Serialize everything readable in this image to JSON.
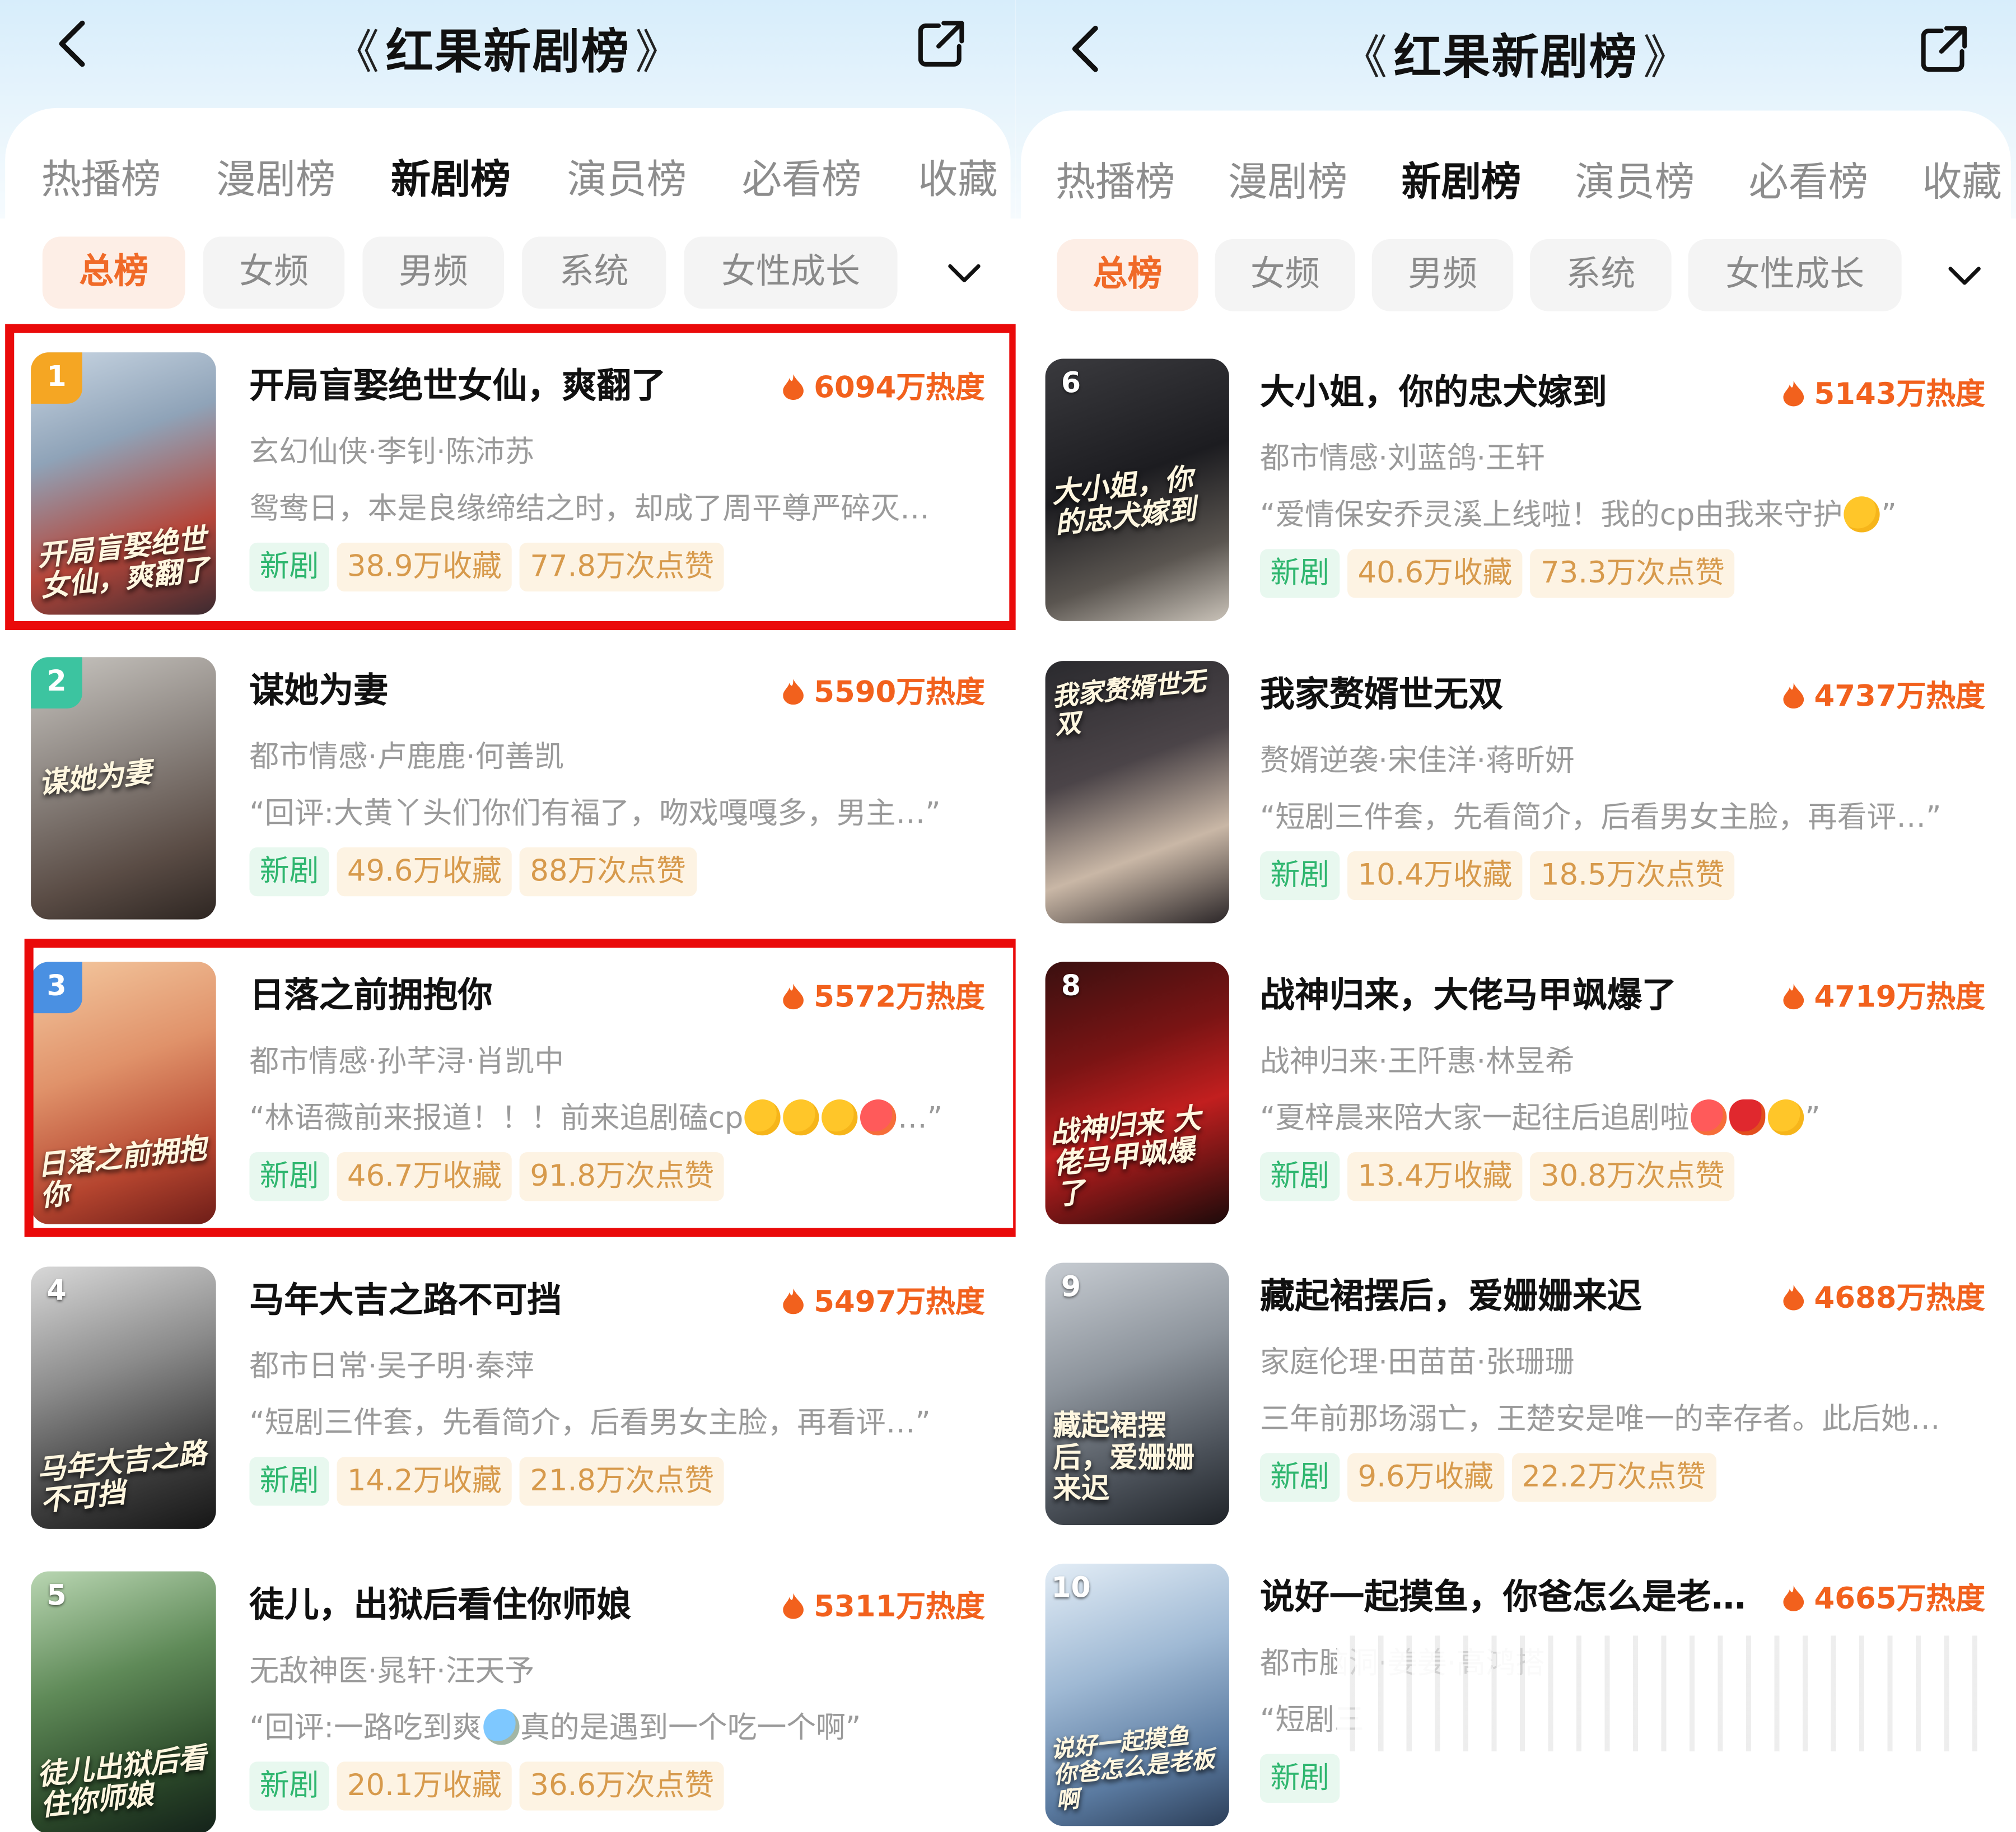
{
  "header": {
    "title": "红果新剧榜",
    "laurel_left": "《",
    "laurel_right": "》"
  },
  "tabs": [
    "热播榜",
    "漫剧榜",
    "新剧榜",
    "演员榜",
    "必看榜",
    "收藏"
  ],
  "active_tab": "新剧榜",
  "chips": [
    "总榜",
    "女频",
    "男频",
    "系统",
    "女性成长"
  ],
  "active_chip": "总榜",
  "left_list": [
    {
      "rank": "1",
      "title": "开局盲娶绝世女仙，爽翻了",
      "heat": "6094万热度",
      "meta": "玄幻仙侠·李钊·陈沛苏",
      "desc": "鸳鸯日，本是良缘缔结之时，却成了周平尊严碎灭…",
      "tag": "新剧",
      "favorites": "38.9万收藏",
      "likes": "77.8万次点赞",
      "cover_text": "开局盲娶绝世女仙，爽翻了",
      "highlighted": true
    },
    {
      "rank": "2",
      "title": "谋她为妻",
      "heat": "5590万热度",
      "meta": "都市情感·卢鹿鹿·何善凯",
      "desc": "“回评:大黄丫头们你们有福了，吻戏嘎嘎多，男主…”",
      "tag": "新剧",
      "favorites": "49.6万收藏",
      "likes": "88万次点赞",
      "cover_text": "谋她为妻",
      "highlighted": false
    },
    {
      "rank": "3",
      "title": "日落之前拥抱你",
      "heat": "5572万热度",
      "meta": "都市情感·孙芊浔·肖凯中",
      "desc": "“林语薇前来报道！！！前来追剧磕cp",
      "desc_tail": "…”",
      "emoji_count": 4,
      "tag": "新剧",
      "favorites": "46.7万收藏",
      "likes": "91.8万次点赞",
      "cover_text": "日落之前拥抱你",
      "highlighted": true
    },
    {
      "rank": "4",
      "title": "马年大吉之路不可挡",
      "heat": "5497万热度",
      "meta": "都市日常·吴子明·秦萍",
      "desc": "“短剧三件套，先看简介，后看男女主脸，再看评…”",
      "tag": "新剧",
      "favorites": "14.2万收藏",
      "likes": "21.8万次点赞",
      "cover_text": "马年大吉之路不可挡",
      "highlighted": false
    },
    {
      "rank": "5",
      "title": "徒儿，出狱后看住你师娘",
      "heat": "5311万热度",
      "meta": "无敌神医·晁轩·汪天予",
      "desc": "“回评:一路吃到爽",
      "desc_tail": "真的是遇到一个吃一个啊”",
      "emoji_count": 1,
      "tag": "新剧",
      "favorites": "20.1万收藏",
      "likes": "36.6万次点赞",
      "cover_text": "徒儿出狱后看住你师娘",
      "highlighted": false
    }
  ],
  "right_list": [
    {
      "rank": "6",
      "title": "大小姐，你的忠犬嫁到",
      "heat": "5143万热度",
      "meta": "都市情感·刘蓝鸽·王轩",
      "desc": "“爱情保安乔灵溪上线啦！我的cp由我来守护",
      "desc_tail": "”",
      "emoji_count": 1,
      "tag": "新剧",
      "favorites": "40.6万收藏",
      "likes": "73.3万次点赞",
      "cover_text": "大小姐，你的忠犬嫁到"
    },
    {
      "rank": "7",
      "title": "我家赘婿世无双",
      "heat": "4737万热度",
      "meta": "赘婿逆袭·宋佳洋·蒋昕妍",
      "desc": "“短剧三件套，先看简介，后看男女主脸，再看评…”",
      "tag": "新剧",
      "favorites": "10.4万收藏",
      "likes": "18.5万次点赞",
      "cover_text": "我家赘婿世无双"
    },
    {
      "rank": "8",
      "title": "战神归来，大佬马甲飒爆了",
      "heat": "4719万热度",
      "meta": "战神归来·王阡惠·林昱希",
      "desc": "“夏梓晨来陪大家一起往后追剧啦",
      "desc_tail": "”",
      "emoji_count": 3,
      "tag": "新剧",
      "favorites": "13.4万收藏",
      "likes": "30.8万次点赞",
      "cover_text": "战神归来 大佬马甲飒爆了"
    },
    {
      "rank": "9",
      "title": "藏起裙摆后，爱姗姗来迟",
      "heat": "4688万热度",
      "meta": "家庭伦理·田苗苗·张珊珊",
      "desc": "三年前那场溺亡，王楚安是唯一的幸存者。此后她…",
      "tag": "新剧",
      "favorites": "9.6万收藏",
      "likes": "22.2万次点赞",
      "cover_text": "藏起裙摆后，爱姗姗来迟"
    },
    {
      "rank": "10",
      "title": "说好一起摸鱼，你爸怎么是老…",
      "heat": "4665万热度",
      "meta": "都市脑洞·姜姜·高鸿搭",
      "desc": "“短剧三",
      "tag": "新剧",
      "cover_text": "说好一起摸鱼 你爸怎么是老板啊"
    }
  ],
  "colors": {
    "accent": "#f2611d",
    "highlight_box": "#ea0a0a",
    "new_tag": "#2fb66f",
    "stat_tag": "#d79a4c",
    "header_bg": "#d7edfb"
  },
  "icons": [
    "back-arrow-icon",
    "share-icon",
    "chevron-down-icon",
    "flame-icon"
  ]
}
